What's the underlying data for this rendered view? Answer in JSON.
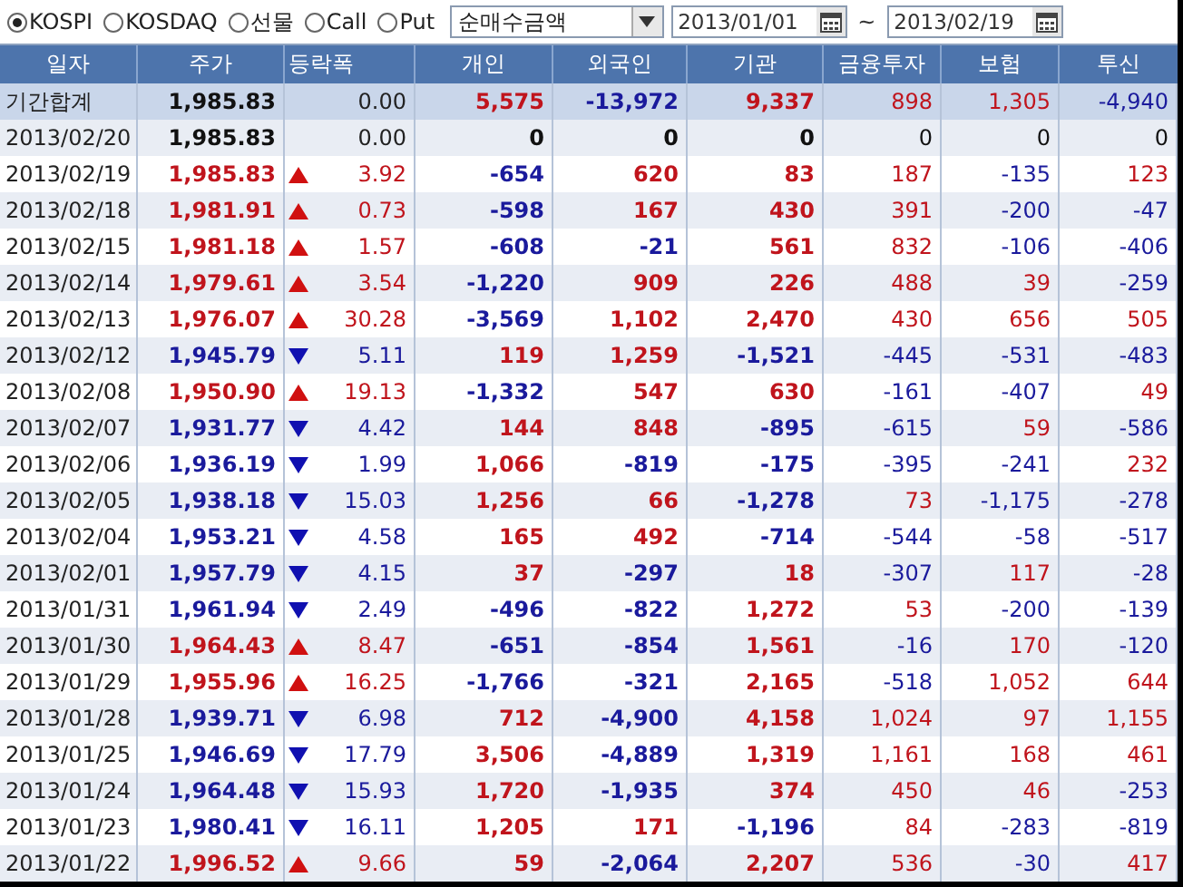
{
  "toolbar": {
    "markets": [
      {
        "label": "KOSPI",
        "selected": true
      },
      {
        "label": "KOSDAQ",
        "selected": false
      },
      {
        "label": "선물",
        "selected": false
      },
      {
        "label": "Call",
        "selected": false
      },
      {
        "label": "Put",
        "selected": false
      }
    ],
    "measure": "순매수금액",
    "date_from": "2013/01/01",
    "separator": "~",
    "date_to": "2013/02/19"
  },
  "table": {
    "columns": [
      "일자",
      "주가",
      "등락폭",
      "개인",
      "외국인",
      "기관",
      "금융투자",
      "보험",
      "투신"
    ],
    "rows": [
      {
        "kind": "summary",
        "date": "기간합계",
        "price": "1,985.83",
        "up": false,
        "down": false,
        "change": "0.00",
        "values": [
          "5,575",
          "-13,972",
          "9,337",
          "898",
          "1,305",
          "-4,940"
        ]
      },
      {
        "kind": "day",
        "date": "2013/02/20",
        "price": "1,985.83",
        "up": false,
        "down": false,
        "change": "0.00",
        "values": [
          "0",
          "0",
          "0",
          "0",
          "0",
          "0"
        ]
      },
      {
        "kind": "day",
        "date": "2013/02/19",
        "price": "1,985.83",
        "up": true,
        "down": false,
        "change": "3.92",
        "values": [
          "-654",
          "620",
          "83",
          "187",
          "-135",
          "123"
        ]
      },
      {
        "kind": "day",
        "date": "2013/02/18",
        "price": "1,981.91",
        "up": true,
        "down": false,
        "change": "0.73",
        "values": [
          "-598",
          "167",
          "430",
          "391",
          "-200",
          "-47"
        ]
      },
      {
        "kind": "day",
        "date": "2013/02/15",
        "price": "1,981.18",
        "up": true,
        "down": false,
        "change": "1.57",
        "values": [
          "-608",
          "-21",
          "561",
          "832",
          "-106",
          "-406"
        ]
      },
      {
        "kind": "day",
        "date": "2013/02/14",
        "price": "1,979.61",
        "up": true,
        "down": false,
        "change": "3.54",
        "values": [
          "-1,220",
          "909",
          "226",
          "488",
          "39",
          "-259"
        ]
      },
      {
        "kind": "day",
        "date": "2013/02/13",
        "price": "1,976.07",
        "up": true,
        "down": false,
        "change": "30.28",
        "values": [
          "-3,569",
          "1,102",
          "2,470",
          "430",
          "656",
          "505"
        ]
      },
      {
        "kind": "day",
        "date": "2013/02/12",
        "price": "1,945.79",
        "up": false,
        "down": true,
        "change": "5.11",
        "values": [
          "119",
          "1,259",
          "-1,521",
          "-445",
          "-531",
          "-483"
        ]
      },
      {
        "kind": "day",
        "date": "2013/02/08",
        "price": "1,950.90",
        "up": true,
        "down": false,
        "change": "19.13",
        "values": [
          "-1,332",
          "547",
          "630",
          "-161",
          "-407",
          "49"
        ]
      },
      {
        "kind": "day",
        "date": "2013/02/07",
        "price": "1,931.77",
        "up": false,
        "down": true,
        "change": "4.42",
        "values": [
          "144",
          "848",
          "-895",
          "-615",
          "59",
          "-586"
        ]
      },
      {
        "kind": "day",
        "date": "2013/02/06",
        "price": "1,936.19",
        "up": false,
        "down": true,
        "change": "1.99",
        "values": [
          "1,066",
          "-819",
          "-175",
          "-395",
          "-241",
          "232"
        ]
      },
      {
        "kind": "day",
        "date": "2013/02/05",
        "price": "1,938.18",
        "up": false,
        "down": true,
        "change": "15.03",
        "values": [
          "1,256",
          "66",
          "-1,278",
          "73",
          "-1,175",
          "-278"
        ]
      },
      {
        "kind": "day",
        "date": "2013/02/04",
        "price": "1,953.21",
        "up": false,
        "down": true,
        "change": "4.58",
        "values": [
          "165",
          "492",
          "-714",
          "-544",
          "-58",
          "-517"
        ]
      },
      {
        "kind": "day",
        "date": "2013/02/01",
        "price": "1,957.79",
        "up": false,
        "down": true,
        "change": "4.15",
        "values": [
          "37",
          "-297",
          "18",
          "-307",
          "117",
          "-28"
        ]
      },
      {
        "kind": "day",
        "date": "2013/01/31",
        "price": "1,961.94",
        "up": false,
        "down": true,
        "change": "2.49",
        "values": [
          "-496",
          "-822",
          "1,272",
          "53",
          "-200",
          "-139"
        ]
      },
      {
        "kind": "day",
        "date": "2013/01/30",
        "price": "1,964.43",
        "up": true,
        "down": false,
        "change": "8.47",
        "values": [
          "-651",
          "-854",
          "1,561",
          "-16",
          "170",
          "-120"
        ]
      },
      {
        "kind": "day",
        "date": "2013/01/29",
        "price": "1,955.96",
        "up": true,
        "down": false,
        "change": "16.25",
        "values": [
          "-1,766",
          "-321",
          "2,165",
          "-518",
          "1,052",
          "644"
        ]
      },
      {
        "kind": "day",
        "date": "2013/01/28",
        "price": "1,939.71",
        "up": false,
        "down": true,
        "change": "6.98",
        "values": [
          "712",
          "-4,900",
          "4,158",
          "1,024",
          "97",
          "1,155"
        ]
      },
      {
        "kind": "day",
        "date": "2013/01/25",
        "price": "1,946.69",
        "up": false,
        "down": true,
        "change": "17.79",
        "values": [
          "3,506",
          "-4,889",
          "1,319",
          "1,161",
          "168",
          "461"
        ]
      },
      {
        "kind": "day",
        "date": "2013/01/24",
        "price": "1,964.48",
        "up": false,
        "down": true,
        "change": "15.93",
        "values": [
          "1,720",
          "-1,935",
          "374",
          "450",
          "46",
          "-253"
        ]
      },
      {
        "kind": "day",
        "date": "2013/01/23",
        "price": "1,980.41",
        "up": false,
        "down": true,
        "change": "16.11",
        "values": [
          "1,205",
          "171",
          "-1,196",
          "84",
          "-283",
          "-819"
        ]
      },
      {
        "kind": "day",
        "date": "2013/01/22",
        "price": "1,996.52",
        "up": true,
        "down": false,
        "change": "9.66",
        "values": [
          "59",
          "-2,064",
          "2,207",
          "536",
          "-30",
          "417"
        ]
      }
    ]
  }
}
